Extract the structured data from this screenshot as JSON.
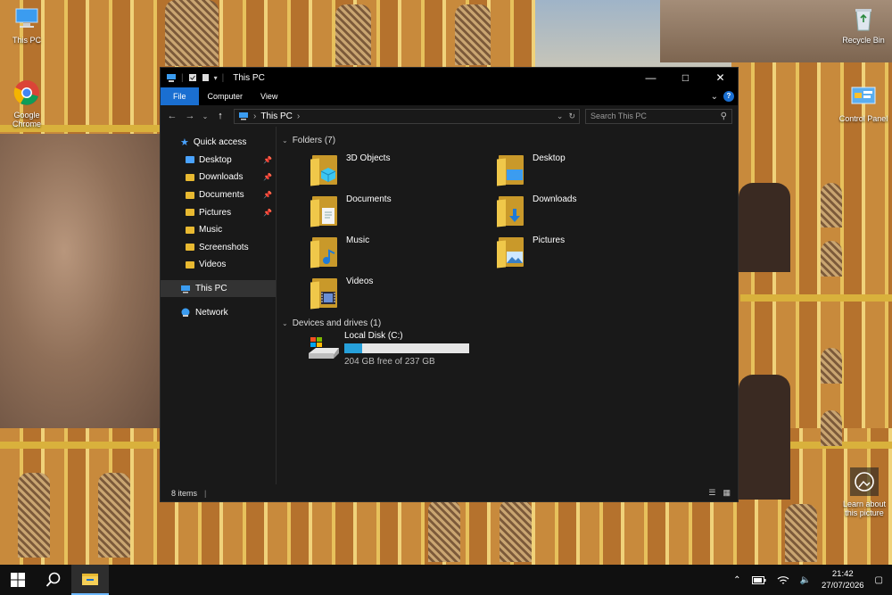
{
  "desktop": {
    "icons": [
      {
        "label": "This PC",
        "icon": "this-pc-icon"
      },
      {
        "label": "Google Chrome",
        "icon": "chrome-icon"
      },
      {
        "label": "Recycle Bin",
        "icon": "recycle-bin-icon"
      },
      {
        "label": "Control Panel",
        "icon": "control-panel-icon"
      },
      {
        "label": "Learn about this picture",
        "icon": "camera-icon"
      }
    ]
  },
  "window": {
    "title": "This PC",
    "ribbon_tabs": [
      "File",
      "Computer",
      "View"
    ],
    "help_label": "?",
    "address": {
      "root": "This PC"
    },
    "search_placeholder": "Search This PC",
    "nav": {
      "quick_access": "Quick access",
      "items": [
        "Desktop",
        "Downloads",
        "Documents",
        "Pictures",
        "Music",
        "Screenshots",
        "Videos"
      ],
      "this_pc": "This PC",
      "network": "Network"
    },
    "folders_header": "Folders (7)",
    "folders": [
      "3D Objects",
      "Desktop",
      "Documents",
      "Downloads",
      "Music",
      "Pictures",
      "Videos"
    ],
    "drives_header": "Devices and drives (1)",
    "drive": {
      "name": "Local Disk (C:)",
      "free_text": "204 GB free of 237 GB",
      "used_fraction": 0.14
    },
    "status": "8 items"
  },
  "taskbar": {
    "time": "21:42",
    "date": "27/07/2026"
  },
  "colors": {
    "accent": "#1a6fd1",
    "folder": "#e8b931",
    "drive_bar": "#26a0da"
  }
}
